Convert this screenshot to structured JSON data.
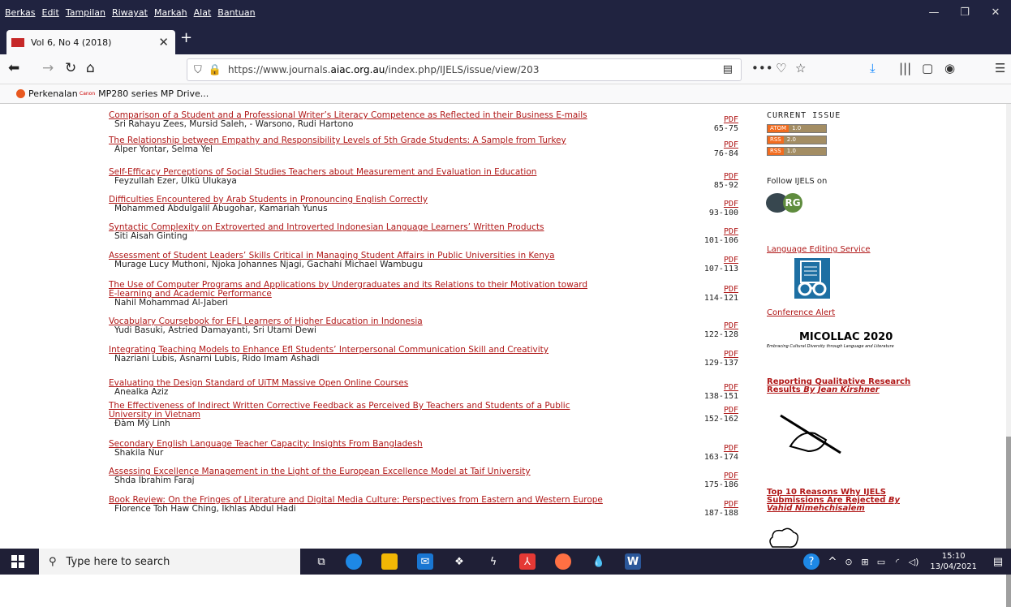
{
  "menu": [
    "Berkas",
    "Edit",
    "Tampilan",
    "Riwayat",
    "Markah",
    "Alat",
    "Bantuan"
  ],
  "tab": {
    "title": "Vol 6, No 4 (2018)"
  },
  "url": {
    "prefix": "https://www.journals.",
    "domain": "aiac.org.au",
    "path": "/index.php/IJELS/issue/view/203"
  },
  "bookmarks": [
    {
      "label": "Perkenalan",
      "icon": "firefox-icon"
    },
    {
      "label": "MP280 series MP Drive...",
      "icon": "canon-icon",
      "badge": "Canon"
    }
  ],
  "articles": [
    {
      "title": [
        "Comparison of a Student and a Professional Writer’s Literacy Competence as Reflected in their Business E-mails"
      ],
      "authors": "Sri Rahayu Zees, Mursid Saleh, - Warsono, Rudi Hartono",
      "pages": "65-75"
    },
    {
      "title": [
        "The Relationship between Empathy and Responsibility Levels of 5th Grade Students: A Sample from Turkey"
      ],
      "authors": "Alper Yontar, Selma Yel",
      "pages": "76-84"
    },
    {
      "title": [
        "Self-Efficacy Perceptions of Social Studies Teachers about Measurement and Evaluation in Education"
      ],
      "authors": "Feyzullah Ezer, Ülkü Ulukaya",
      "pages": "85-92"
    },
    {
      "title": [
        "Difficulties Encountered by Arab Students in Pronouncing English Correctly"
      ],
      "authors": "Mohammed Abdulgalil Abugohar, Kamariah Yunus",
      "pages": "93-100"
    },
    {
      "title": [
        "Syntactic Complexity on Extroverted and Introverted Indonesian Language Learners’ Written Products"
      ],
      "authors": "Siti Aisah Ginting",
      "pages": "101-106"
    },
    {
      "title": [
        "Assessment of Student Leaders’ Skills Critical in Managing Student Affairs in Public Universities in Kenya"
      ],
      "authors": "Murage Lucy Muthoni, Njoka Johannes Njagi, Gachahi Michael Wambugu",
      "pages": "107-113"
    },
    {
      "title": [
        "The Use of Computer Programs and Applications by Undergraduates and its Relations to their Motivation toward",
        "E-learning and Academic Performance"
      ],
      "authors": "Nahil Mohammad Al-Jaberi",
      "pages": "114-121"
    },
    {
      "title": [
        "Vocabulary Coursebook for EFL Learners of Higher Education in Indonesia"
      ],
      "authors": "Yudi Basuki, Astried Damayanti, Sri Utami Dewi",
      "pages": "122-128"
    },
    {
      "title": [
        "Integrating Teaching Models to Enhance Efl Students’ Interpersonal Communication Skill and Creativity"
      ],
      "authors": "Nazriani Lubis, Asnarni Lubis, Rido Imam Ashadi",
      "pages": "129-137"
    },
    {
      "title": [
        "Evaluating the Design Standard of UiTM Massive Open Online Courses"
      ],
      "authors": "Anealka Aziz",
      "pages": "138-151"
    },
    {
      "title": [
        "The Effectiveness of Indirect Written Corrective Feedback as Perceived By Teachers and Students of a Public",
        "University in Vietnam"
      ],
      "authors": "Đàm Mỹ Linh",
      "pages": "152-162"
    },
    {
      "title": [
        "Secondary English Language Teacher Capacity: Insights From Bangladesh"
      ],
      "authors": "Shakila Nur",
      "pages": "163-174"
    },
    {
      "title": [
        "Assessing Excellence Management in the Light of the European Excellence Model at Taif University"
      ],
      "authors": "Shda Ibrahim Faraj",
      "pages": "175-186"
    },
    {
      "title": [
        "Book Review: On the Fringes of Literature and Digital Media Culture: Perspectives from Eastern and Western Europe"
      ],
      "authors": "Florence Toh Haw Ching, Ikhlas Abdul Hadi",
      "pages": "187-188"
    }
  ],
  "pdf_label": "PDF",
  "sidebar": {
    "current_issue": "CURRENT ISSUE",
    "feeds": [
      {
        "k": "ATOM",
        "v": "1.0"
      },
      {
        "k": "RSS",
        "v": "2.0"
      },
      {
        "k": "RSS",
        "v": "1.0"
      }
    ],
    "follow": "Follow IJELS on",
    "rg": "RG",
    "editing": "Language Editing Service",
    "alert": "Conference Alert",
    "micollac": "MICOLLAC 2020",
    "micollac_sub": "Embracing Cultural Diversity through Language and Literature",
    "reporting": [
      "Reporting Qualitative Research",
      "Results "
    ],
    "reporting_by": "By Jean Kirshner",
    "top10": [
      "Top 10 Reasons Why IJELS",
      "Submissions Are Rejected "
    ],
    "top10_by1": "By",
    "top10_by2": "Vahid Nimehchisalem"
  },
  "taskbar": {
    "search_placeholder": "Type here to search",
    "time": "15:10",
    "date": "13/04/2021"
  }
}
